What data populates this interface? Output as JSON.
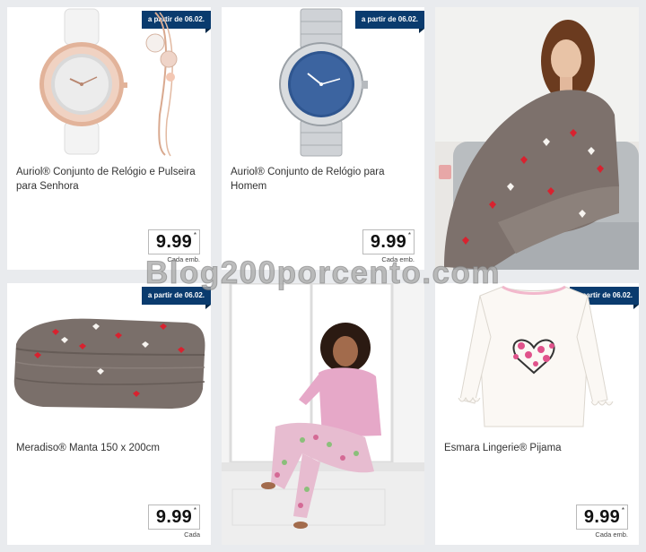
{
  "watermark": "Blog200porcento.com",
  "products": [
    {
      "badge": "a partir de 06.02.",
      "title": "Auriol® Conjunto de Relógio e Pulseira para Senhora",
      "price": "9.99",
      "price_mark": "*",
      "unit": "Cada emb.",
      "image": "womens-watch-and-bracelet-set-image"
    },
    {
      "badge": "a partir de 06.02.",
      "title": "Auriol® Conjunto de Relógio para Homem",
      "price": "9.99",
      "price_mark": "*",
      "unit": "Cada emb.",
      "image": "mens-watch-image"
    },
    {
      "badge": "a partir de 06.02.",
      "title": "Meradiso® Manta 150 x 200cm",
      "price": "9.99",
      "price_mark": "*",
      "unit": "Cada",
      "image": "folded-blanket-image"
    },
    {
      "badge": "a partir de 06.02.",
      "title": "Esmara Lingerie® Pijama",
      "price": "9.99",
      "price_mark": "*",
      "unit": "Cada emb.",
      "image": "pajama-top-image"
    }
  ],
  "lifestyle_images": [
    {
      "image": "woman-wrapped-in-blanket-photo"
    },
    {
      "image": "woman-in-pajamas-at-window-photo"
    }
  ],
  "colors": {
    "badge": "#0a3b6e",
    "background": "#e9ebee",
    "heart_red": "#d8222f",
    "blanket": "#7d716c"
  }
}
